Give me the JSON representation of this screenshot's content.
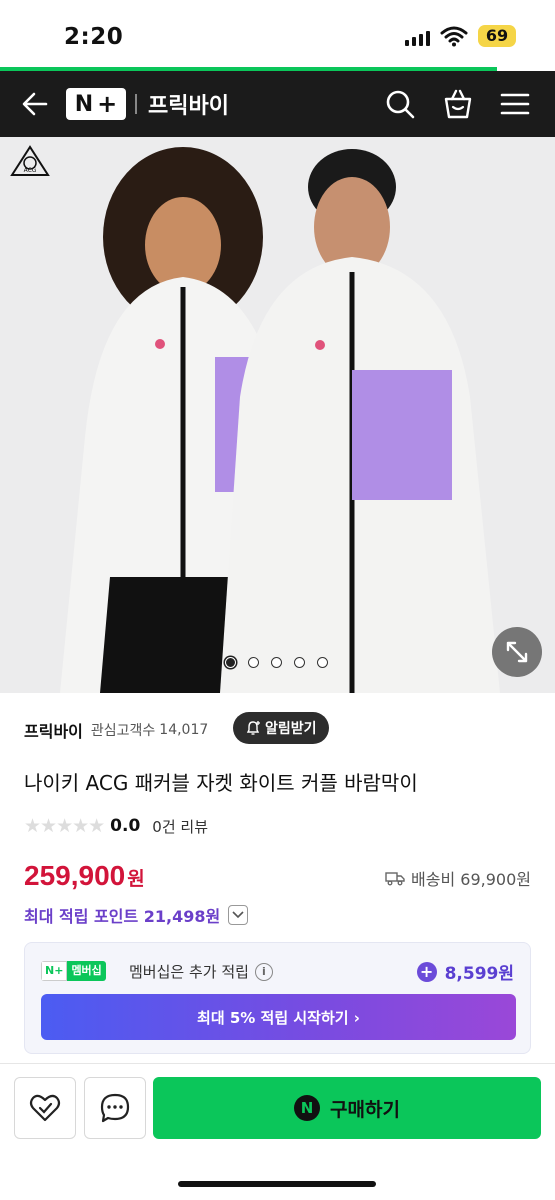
{
  "status_bar": {
    "time": "2:20",
    "battery": "69"
  },
  "header": {
    "store_name": "프릭바이",
    "logo_text": "N+"
  },
  "product_image": {
    "brand_logo": "ACG",
    "total_slides": 5,
    "active_slide": 1
  },
  "store": {
    "name": "프릭바이",
    "favorites_label": "관심고객수",
    "favorites_count": "14,017",
    "alarm_label": "알림받기"
  },
  "product": {
    "title": "나이키 ACG 패커블 자켓 화이트 커플 바람막이",
    "rating_score": "0.0",
    "review_count": "0건 리뷰",
    "price": "259,900",
    "price_unit": "원",
    "shipping": "배송비 69,900원",
    "points_label": "최대 적립 포인트 21,498원"
  },
  "membership": {
    "badge_n": "N+",
    "badge_label": "멤버십",
    "text": "멤버십은 추가 적립",
    "extra_points": "8,599원",
    "start_button": "최대 5% 적립 시작하기 ›"
  },
  "bottom_bar": {
    "buy_label": "구매하기",
    "buy_logo": "N"
  },
  "colors": {
    "accent_green": "#0bc65a",
    "price_red": "#d2143a",
    "points_purple": "#6b3fc9"
  }
}
